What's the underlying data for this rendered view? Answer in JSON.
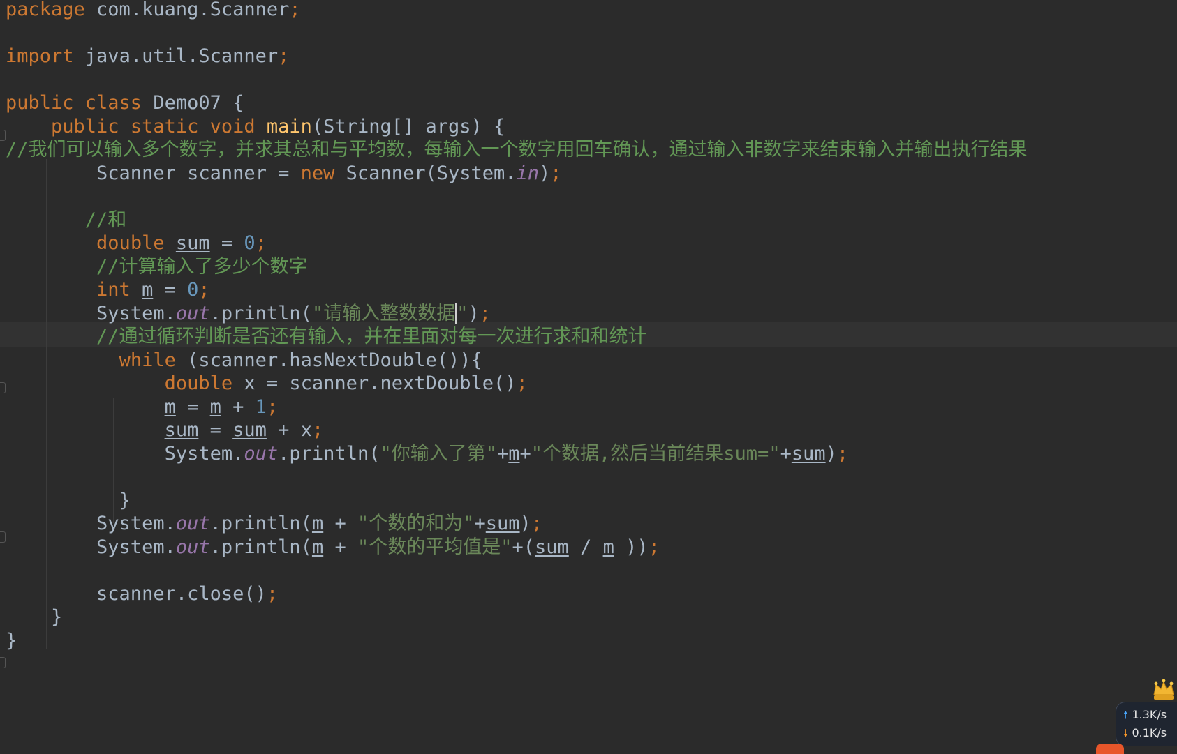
{
  "editor": {
    "lines": [
      [
        [
          "kw",
          "package "
        ],
        [
          "id",
          "com.kuang.Scanner"
        ],
        [
          "kw",
          ";"
        ]
      ],
      [],
      [
        [
          "kw",
          "import "
        ],
        [
          "id",
          "java.util.Scanner"
        ],
        [
          "kw",
          ";"
        ]
      ],
      [],
      [
        [
          "kw",
          "public class "
        ],
        [
          "id",
          "Demo07 {"
        ]
      ],
      [
        [
          "id",
          "    "
        ],
        [
          "kw",
          "public static void "
        ],
        [
          "fn",
          "main"
        ],
        [
          "id",
          "(String[] args) {"
        ]
      ],
      [
        [
          "cm",
          "//我们可以输入多个数字，并求其总和与平均数，每输入一个数字用回车确认，通过输入非数字来结束输入并输出执行结果"
        ]
      ],
      [
        [
          "id",
          "        Scanner scanner = "
        ],
        [
          "kw",
          "new "
        ],
        [
          "id",
          "Scanner(System."
        ],
        [
          "st",
          "in"
        ],
        [
          "id",
          ")"
        ],
        [
          "kw",
          ";"
        ]
      ],
      [],
      [
        [
          "cm",
          "       //和"
        ]
      ],
      [
        [
          "id",
          "        "
        ],
        [
          "kw",
          "double "
        ],
        [
          "var",
          "sum"
        ],
        [
          "id",
          " = "
        ],
        [
          "num",
          "0"
        ],
        [
          "kw",
          ";"
        ]
      ],
      [
        [
          "cm",
          "        //计算输入了多少个数字"
        ]
      ],
      [
        [
          "id",
          "        "
        ],
        [
          "kw",
          "int "
        ],
        [
          "var",
          "m"
        ],
        [
          "id",
          " = "
        ],
        [
          "num",
          "0"
        ],
        [
          "kw",
          ";"
        ]
      ],
      [
        [
          "id",
          "        System."
        ],
        [
          "st",
          "out"
        ],
        [
          "id",
          ".println("
        ],
        [
          "str",
          "\"请输入整数数据"
        ],
        [
          "caret",
          ""
        ],
        [
          "str",
          "\""
        ],
        [
          "id",
          ")"
        ],
        [
          "kw",
          ";"
        ]
      ],
      [
        [
          "cm",
          "        //通过循环判断是否还有输入，并在里面对每一次进行求和和统计"
        ]
      ],
      [
        [
          "id",
          "          "
        ],
        [
          "kw",
          "while "
        ],
        [
          "id",
          "(scanner.hasNextDouble()){"
        ]
      ],
      [
        [
          "id",
          "              "
        ],
        [
          "kw",
          "double "
        ],
        [
          "id",
          "x = scanner.nextDouble()"
        ],
        [
          "kw",
          ";"
        ]
      ],
      [
        [
          "id",
          "              "
        ],
        [
          "var",
          "m"
        ],
        [
          "id",
          " = "
        ],
        [
          "var",
          "m"
        ],
        [
          "id",
          " + "
        ],
        [
          "num",
          "1"
        ],
        [
          "kw",
          ";"
        ]
      ],
      [
        [
          "id",
          "              "
        ],
        [
          "var",
          "sum"
        ],
        [
          "id",
          " = "
        ],
        [
          "var",
          "sum"
        ],
        [
          "id",
          " + x"
        ],
        [
          "kw",
          ";"
        ]
      ],
      [
        [
          "id",
          "              System."
        ],
        [
          "st",
          "out"
        ],
        [
          "id",
          ".println("
        ],
        [
          "str",
          "\"你输入了第\""
        ],
        [
          "id",
          "+"
        ],
        [
          "var",
          "m"
        ],
        [
          "id",
          "+"
        ],
        [
          "str",
          "\"个数据,然后当前结果sum=\""
        ],
        [
          "id",
          "+"
        ],
        [
          "var",
          "sum"
        ],
        [
          "id",
          ")"
        ],
        [
          "kw",
          ";"
        ]
      ],
      [],
      [
        [
          "id",
          "          }"
        ]
      ],
      [
        [
          "id",
          "        System."
        ],
        [
          "st",
          "out"
        ],
        [
          "id",
          ".println("
        ],
        [
          "var",
          "m"
        ],
        [
          "id",
          " + "
        ],
        [
          "str",
          "\"个数的和为\""
        ],
        [
          "id",
          "+"
        ],
        [
          "var",
          "sum"
        ],
        [
          "id",
          ")"
        ],
        [
          "kw",
          ";"
        ]
      ],
      [
        [
          "id",
          "        System."
        ],
        [
          "st",
          "out"
        ],
        [
          "id",
          ".println("
        ],
        [
          "var",
          "m"
        ],
        [
          "id",
          " + "
        ],
        [
          "str",
          "\"个数的平均值是\""
        ],
        [
          "id",
          "+("
        ],
        [
          "var",
          "sum"
        ],
        [
          "id",
          " / "
        ],
        [
          "var",
          "m"
        ],
        [
          "id",
          " ))"
        ],
        [
          "kw",
          ";"
        ]
      ],
      [],
      [
        [
          "id",
          "        scanner.close()"
        ],
        [
          "kw",
          ";"
        ]
      ],
      [
        [
          "id",
          "    }"
        ]
      ],
      [
        [
          "id",
          "}"
        ]
      ]
    ]
  },
  "network_widget": {
    "upload_speed": "1.3K/s",
    "download_speed": "0.1K/s"
  },
  "icons": {
    "vip": "vip-crown-icon",
    "upload": "arrow-up-icon",
    "download": "arrow-down-icon"
  },
  "colors": {
    "background": "#2b2b2b",
    "keyword": "#cc7832",
    "comment": "#629755",
    "string": "#6a8759",
    "number": "#6897bb",
    "static_field": "#9876aa",
    "method_decl": "#ffc66d",
    "default_text": "#a9b7c6"
  }
}
